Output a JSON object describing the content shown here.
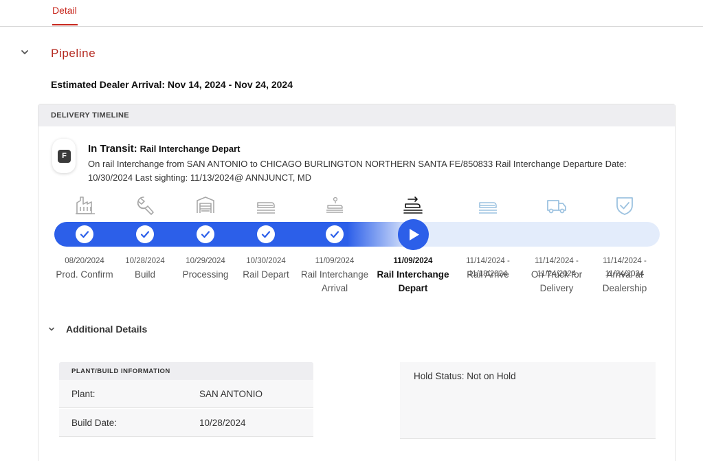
{
  "tabs": [
    {
      "label": "Detail",
      "active": true
    }
  ],
  "section": {
    "title": "Pipeline"
  },
  "arrival": {
    "text": "Estimated Dealer Arrival: Nov 14, 2024 - Nov 24, 2024"
  },
  "timeline": {
    "header": "DELIVERY TIMELINE",
    "badge_letter": "F",
    "status_label": "In Transit:",
    "status_value": "Rail Interchange Depart",
    "description": "On rail Interchange from SAN ANTONIO to CHICAGO BURLINGTON NORTHERN SANTA FE/850833 Rail Interchange Departure Date: 10/30/2024 Last sighting: 11/13/2024@ ANNJUNCT, MD",
    "progress_fraction": 0.59,
    "stages": [
      {
        "date": "08/20/2024",
        "name": "Prod. Confirm",
        "state": "done",
        "icon": "factory-icon"
      },
      {
        "date": "10/28/2024",
        "name": "Build",
        "state": "done",
        "icon": "wrench-icon"
      },
      {
        "date": "10/29/2024",
        "name": "Processing",
        "state": "done",
        "icon": "processing-garage-icon"
      },
      {
        "date": "10/30/2024",
        "name": "Rail Depart",
        "state": "done",
        "icon": "rail-car-icon"
      },
      {
        "date": "11/09/2024",
        "name": "Rail Interchange Arrival",
        "state": "done",
        "icon": "rail-interchange-arrival-icon"
      },
      {
        "date": "11/09/2024",
        "name": "Rail Interchange Depart",
        "state": "current",
        "icon": "rail-interchange-depart-icon"
      },
      {
        "date": "11/14/2024 - 11/18/2024",
        "name": "Rail Arrive",
        "state": "upcoming",
        "icon": "rail-arrive-icon"
      },
      {
        "date": "11/14/2024 - 11/24/2024",
        "name": "On Truck for Delivery",
        "state": "upcoming",
        "icon": "truck-icon"
      },
      {
        "date": "11/14/2024 - 11/24/2024",
        "name": "Arrival at Dealership",
        "state": "upcoming",
        "icon": "shield-check-icon"
      }
    ]
  },
  "additional": {
    "title": "Additional Details",
    "plant": {
      "header": "PLANT/BUILD INFORMATION",
      "rows": [
        {
          "key": "Plant:",
          "value": "SAN ANTONIO"
        },
        {
          "key": "Build Date:",
          "value": "10/28/2024"
        }
      ]
    },
    "hold": {
      "text": "Hold Status: Not on Hold"
    }
  },
  "colors": {
    "accent_red": "#c8281e",
    "progress_blue": "#2c5fe9",
    "track_light": "#e3ecfb",
    "done_icon": "#a8a8a8",
    "upcoming_icon": "#9cc2e0"
  }
}
